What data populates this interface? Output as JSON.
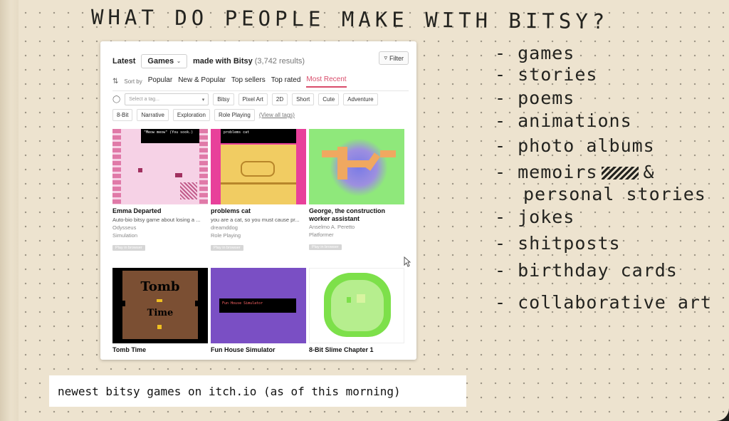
{
  "notebook": {
    "headline": "WHAT DO PEOPLE MAKE WITH BITSY?",
    "list": [
      "- games",
      "- stories",
      "- poems",
      "- animations",
      "- photo albums",
      "- memoirs",
      "personal stories",
      "- jokes",
      "- shitposts",
      "- birthday cards",
      "- collaborative art"
    ],
    "ampersand": "&"
  },
  "itch": {
    "latest": "Latest",
    "category": "Games",
    "made_with": "made with Bitsy",
    "count": "(3,742 results)",
    "filter": "Filter",
    "sort_label": "Sort by",
    "sort_options": [
      "Popular",
      "New & Popular",
      "Top sellers",
      "Top rated",
      "Most Recent"
    ],
    "active_sort": "Most Recent",
    "tag_placeholder": "Select a tag...",
    "tags_row1": [
      "Bitsy",
      "Pixel Art",
      "2D",
      "Short",
      "Cute",
      "Adventure"
    ],
    "tags_row2": [
      "8-Bit",
      "Narrative",
      "Exploration",
      "Role Playing"
    ],
    "view_all": "(View all tags)",
    "games": [
      {
        "title": "Emma Departed",
        "desc": "Auto-bio bitsy game about losing a ...",
        "author": "Odysseus",
        "genre": "Simulation",
        "badge": "Play in browser",
        "thumb_text": "\"Meow meow\" (You sook.)"
      },
      {
        "title": "problems cat",
        "desc": "you are a cat, so you must cause pr...",
        "author": "dreamddog",
        "genre": "Role Playing",
        "badge": "Play in browser",
        "thumb_text": "problems cat"
      },
      {
        "title": "George, the construction worker assistant",
        "desc": "",
        "author": "Anselmo A. Peretto",
        "genre": "Platformer",
        "badge": "Play in browser",
        "thumb_text": ""
      },
      {
        "title": "Tomb Time",
        "desc": "",
        "author": "",
        "genre": "",
        "badge": "",
        "thumb_text": "Tomb Time"
      },
      {
        "title": "Fun House Simulator",
        "desc": "",
        "author": "",
        "genre": "",
        "badge": "",
        "thumb_text": "Fun House Simulator"
      },
      {
        "title": "8-Bit Slime Chapter 1",
        "desc": "",
        "author": "",
        "genre": "",
        "badge": "",
        "thumb_text": ""
      }
    ]
  },
  "caption": "newest bitsy games on itch.io (as of this morning)",
  "colors": {
    "accent": "#d94d6b",
    "paper": "#ede3cf",
    "ink": "#23231f"
  }
}
